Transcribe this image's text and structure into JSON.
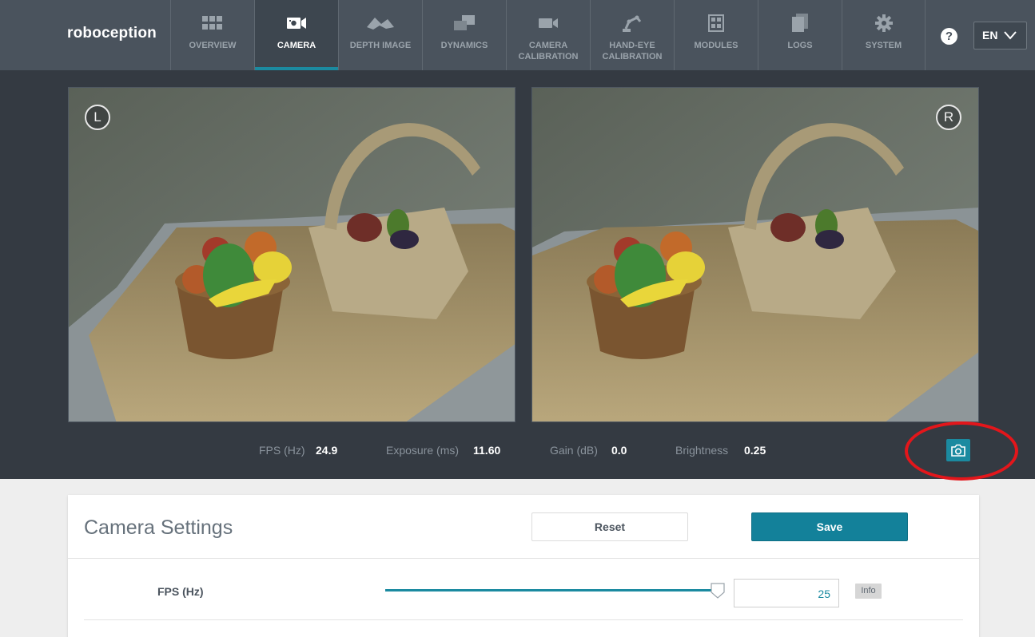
{
  "header": {
    "logo": "roboception",
    "nav": [
      {
        "label": "OVERVIEW",
        "icon": "grid-icon"
      },
      {
        "label": "CAMERA",
        "icon": "camera-icon",
        "active": true
      },
      {
        "label": "DEPTH IMAGE",
        "icon": "depth-image-icon"
      },
      {
        "label": "DYNAMICS",
        "icon": "dynamics-icon"
      },
      {
        "label": "CAMERA CALIBRATION",
        "icon": "video-camera-icon"
      },
      {
        "label": "HAND-EYE CALIBRATION",
        "icon": "robot-arm-icon"
      },
      {
        "label": "MODULES",
        "icon": "modules-icon"
      },
      {
        "label": "LOGS",
        "icon": "logs-icon"
      },
      {
        "label": "SYSTEM",
        "icon": "gear-icon"
      }
    ],
    "help_label": "?",
    "language": "EN"
  },
  "viewer": {
    "left_badge": "L",
    "right_badge": "R",
    "stats": {
      "fps_label": "FPS (Hz)",
      "fps_value": "24.9",
      "exposure_label": "Exposure (ms)",
      "exposure_value": "11.60",
      "gain_label": "Gain (dB)",
      "gain_value": "0.0",
      "brightness_label": "Brightness",
      "brightness_value": "0.25"
    },
    "snapshot_icon": "camera-snapshot-icon"
  },
  "settings": {
    "title": "Camera Settings",
    "reset_label": "Reset",
    "save_label": "Save",
    "fps_row": {
      "label": "FPS (Hz)",
      "value": "25",
      "slider_fraction": 1.0,
      "info_label": "Info"
    }
  },
  "colors": {
    "header_bg": "#4a535d",
    "viewer_bg": "#343a42",
    "accent": "#1b8aa0",
    "highlight": "#e3161b"
  }
}
